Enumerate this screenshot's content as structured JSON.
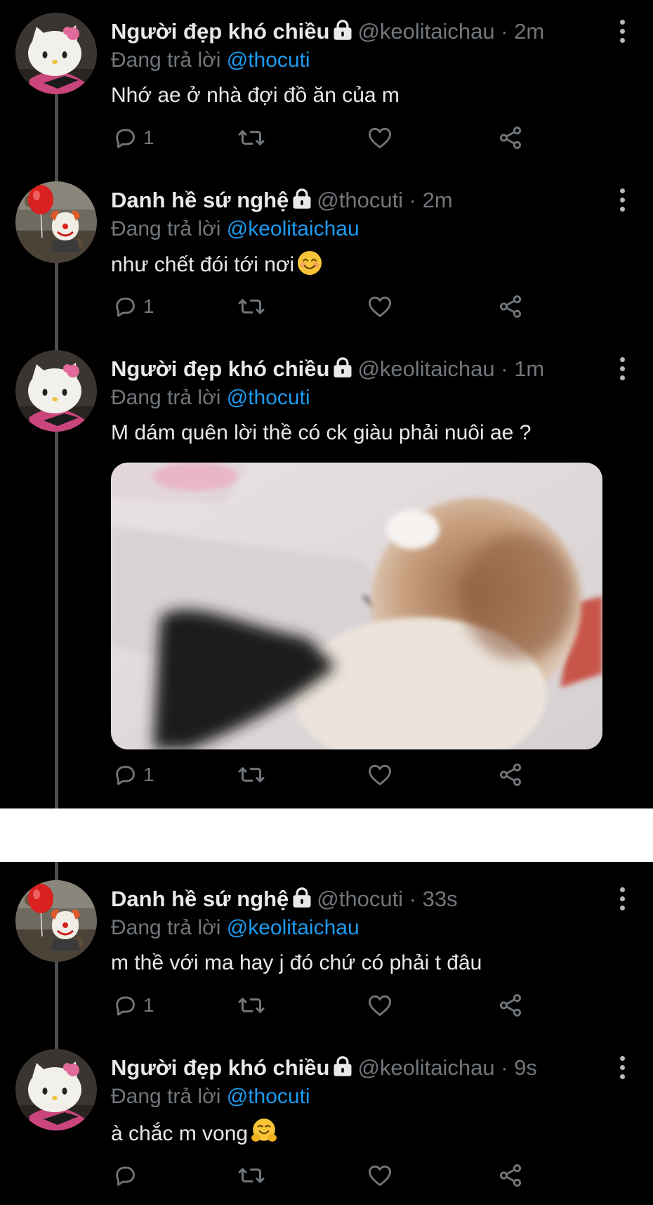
{
  "tweets": [
    {
      "name": "Người đẹp khó chiều",
      "meta": "@keolitaichau · 2m",
      "reply_prefix": "Đang trả lời",
      "reply_handle": "@thocuti",
      "text": "Nhớ ae ở nhà đợi đồ ăn của m",
      "reply_count": "1",
      "avatar": "hello-kitty"
    },
    {
      "name": "Danh hề sứ nghệ",
      "meta": "@thocuti · 2m",
      "reply_prefix": "Đang trả lời",
      "reply_handle": "@keolitaichau",
      "text": "như chết đói tới nơi",
      "text_emoji": "smiling-face-emoji",
      "reply_count": "1",
      "avatar": "clown-balloon"
    },
    {
      "name": "Người đẹp khó chiều",
      "meta": "@keolitaichau · 1m",
      "reply_prefix": "Đang trả lời",
      "reply_handle": "@thocuti",
      "text": "M dám quên lời thề có ck giàu phải nuôi ae ?",
      "media": "cat-photo",
      "reply_count": "1",
      "avatar": "hello-kitty"
    },
    {
      "name": "Danh hề sứ nghệ",
      "meta": "@thocuti · 33s",
      "reply_prefix": "Đang trả lời",
      "reply_handle": "@keolitaichau",
      "text": "m thề với ma hay j đó chứ có phải t đâu",
      "reply_count": "1",
      "avatar": "clown-balloon"
    },
    {
      "name": "Người đẹp khó chiều",
      "meta": "@keolitaichau · 9s",
      "reply_prefix": "Đang trả lời",
      "reply_handle": "@thocuti",
      "text": "à chắc m vong",
      "text_emoji": "hugging-face-emoji",
      "reply_count": "",
      "avatar": "hello-kitty"
    }
  ],
  "icons": [
    "reply-icon",
    "retweet-icon",
    "like-icon",
    "share-icon",
    "lock-icon",
    "more-icon"
  ],
  "colors": {
    "background": "#000000",
    "text": "#e7e9ea",
    "muted": "#71767b",
    "link": "#1d9bf0",
    "thread_line": "#4a4e52"
  }
}
